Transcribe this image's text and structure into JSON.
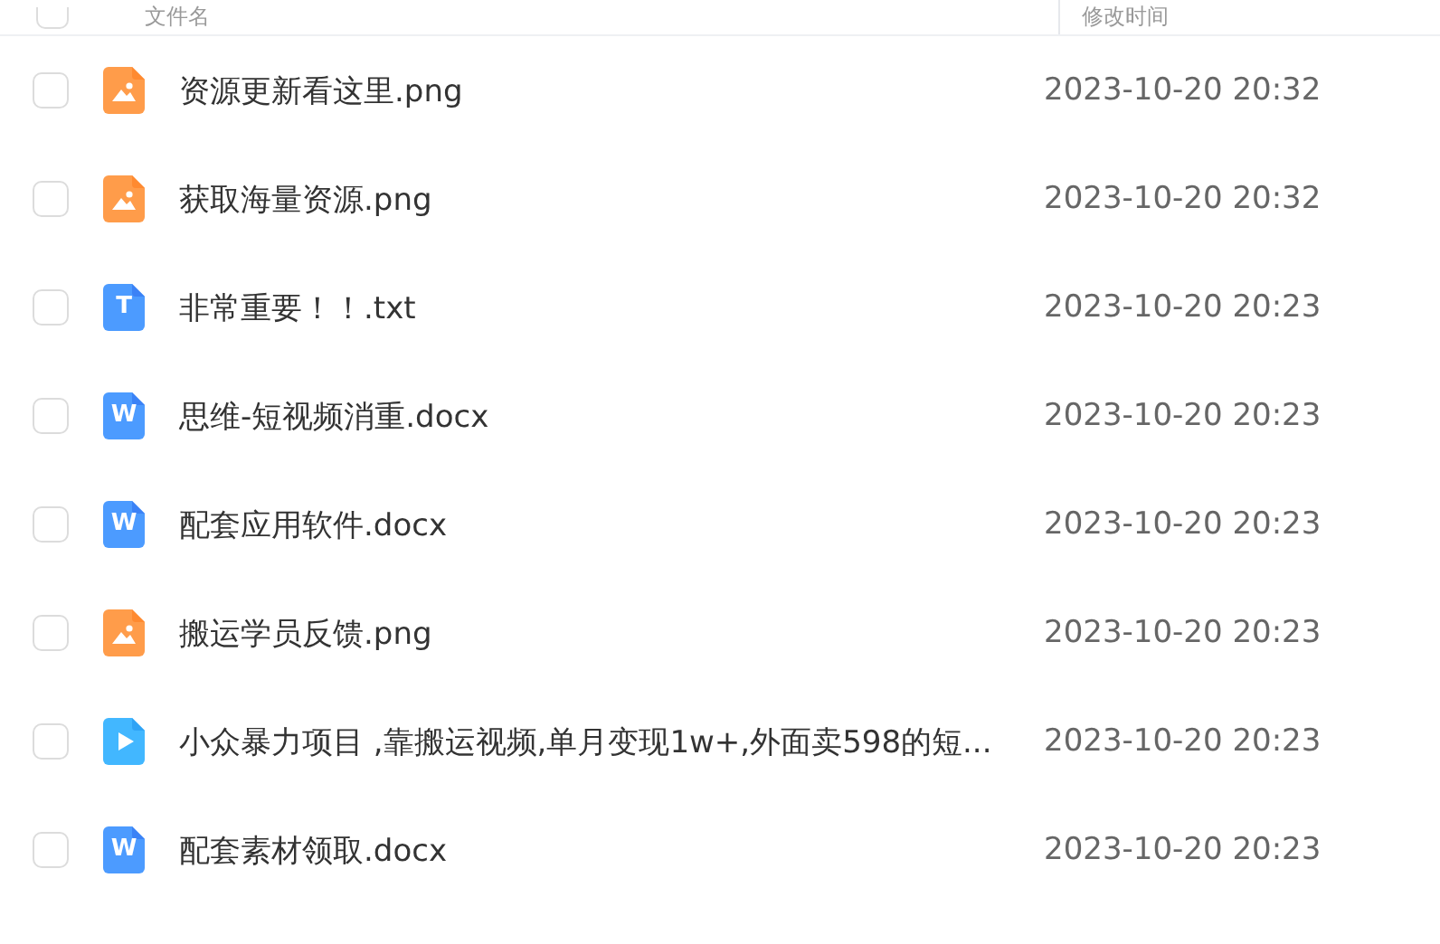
{
  "header": {
    "columns": [
      {
        "label": "文件名"
      },
      {
        "label": "修改时间"
      }
    ],
    "select_all": {
      "checked": false
    }
  },
  "files": [
    {
      "name": "资源更新看这里.png",
      "modified": "2023-10-20 20:32",
      "kind": "image",
      "checked": false
    },
    {
      "name": "获取海量资源.png",
      "modified": "2023-10-20 20:32",
      "kind": "image",
      "checked": false
    },
    {
      "name": "非常重要！！.txt",
      "modified": "2023-10-20 20:23",
      "kind": "text",
      "glyph": "T",
      "checked": false
    },
    {
      "name": "思维-短视频消重.docx",
      "modified": "2023-10-20 20:23",
      "kind": "word",
      "glyph": "W",
      "checked": false
    },
    {
      "name": "配套应用软件.docx",
      "modified": "2023-10-20 20:23",
      "kind": "word",
      "glyph": "W",
      "checked": false
    },
    {
      "name": "搬运学员反馈.png",
      "modified": "2023-10-20 20:23",
      "kind": "image",
      "checked": false
    },
    {
      "name": "小众暴力项目 ,靠搬运视频,单月变现1w+,外面卖598的短...",
      "modified": "2023-10-20 20:23",
      "kind": "video",
      "checked": false
    },
    {
      "name": "配套素材领取.docx",
      "modified": "2023-10-20 20:23",
      "kind": "word",
      "glyph": "W",
      "checked": false
    }
  ]
}
